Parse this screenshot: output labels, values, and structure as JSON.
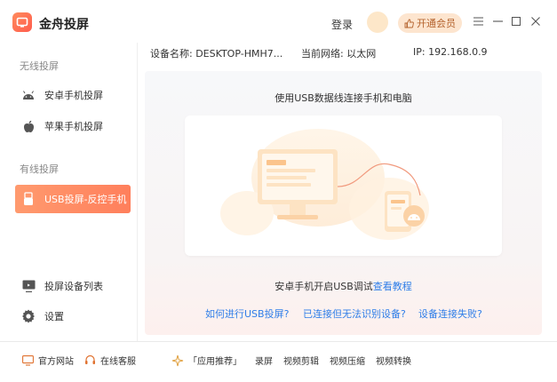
{
  "app": {
    "title": "金舟投屏"
  },
  "header": {
    "login_label": "登录",
    "vip_label": "开通会员"
  },
  "sidebar": {
    "wireless_label": "无线投屏",
    "wired_label": "有线投屏",
    "items": [
      {
        "label": "安卓手机投屏"
      },
      {
        "label": "苹果手机投屏"
      },
      {
        "label": "USB投屏-反控手机"
      },
      {
        "label": "投屏设备列表"
      },
      {
        "label": "设置"
      }
    ]
  },
  "device_info": {
    "name": "设备名称: DESKTOP-HMH7...",
    "network": "当前网络: 以太网",
    "ip": "IP: 192.168.0.9"
  },
  "main": {
    "headline": "使用USB数据线连接手机和电脑",
    "tutorial_prefix": "安卓手机开启USB调试",
    "tutorial_link": "查看教程",
    "help_links": [
      "如何进行USB投屏?",
      "已连接但无法识别设备?",
      "设备连接失败?"
    ]
  },
  "footer": {
    "website": "官方网站",
    "support": "在线客服",
    "recommend": "「应用推荐」",
    "apps": [
      "录屏",
      "视频剪辑",
      "视频压缩",
      "视频转换"
    ]
  },
  "colors": {
    "accent": "#ff7f5c",
    "link": "#2f7ee8",
    "vip_bg": "#fde5cf"
  }
}
